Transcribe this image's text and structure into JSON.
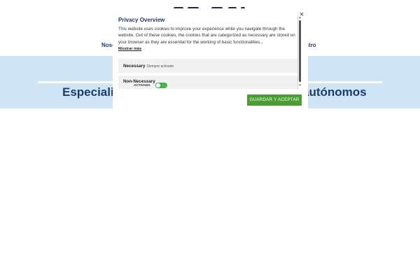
{
  "page": {
    "nav_left_text": "Noso",
    "nav_right_text": "estro",
    "hero_title_left": "Especializ",
    "hero_title_right": "autónomos"
  },
  "modal": {
    "title": "Privacy Overview",
    "body": "This website uses cookies to improve your experience while you navigate through the website. Out of these cookies, the cookies that are categorized as necessary are stored on your browser as they are essential for the working of basic functionalities...",
    "show_more": "Mostrar más",
    "categories": [
      {
        "name": "Necessary",
        "status": "Siempre activado"
      },
      {
        "name": "Non-Necessary",
        "toggle_label": "ACTIVADO",
        "enabled": true
      }
    ],
    "close_icon": "×",
    "accept_label": "GUARDAR Y ACEPTAR"
  },
  "colors": {
    "accent_green": "#4a9d31",
    "brand_navy": "#1e3a6e",
    "hero_bg": "#cfe5f5"
  }
}
